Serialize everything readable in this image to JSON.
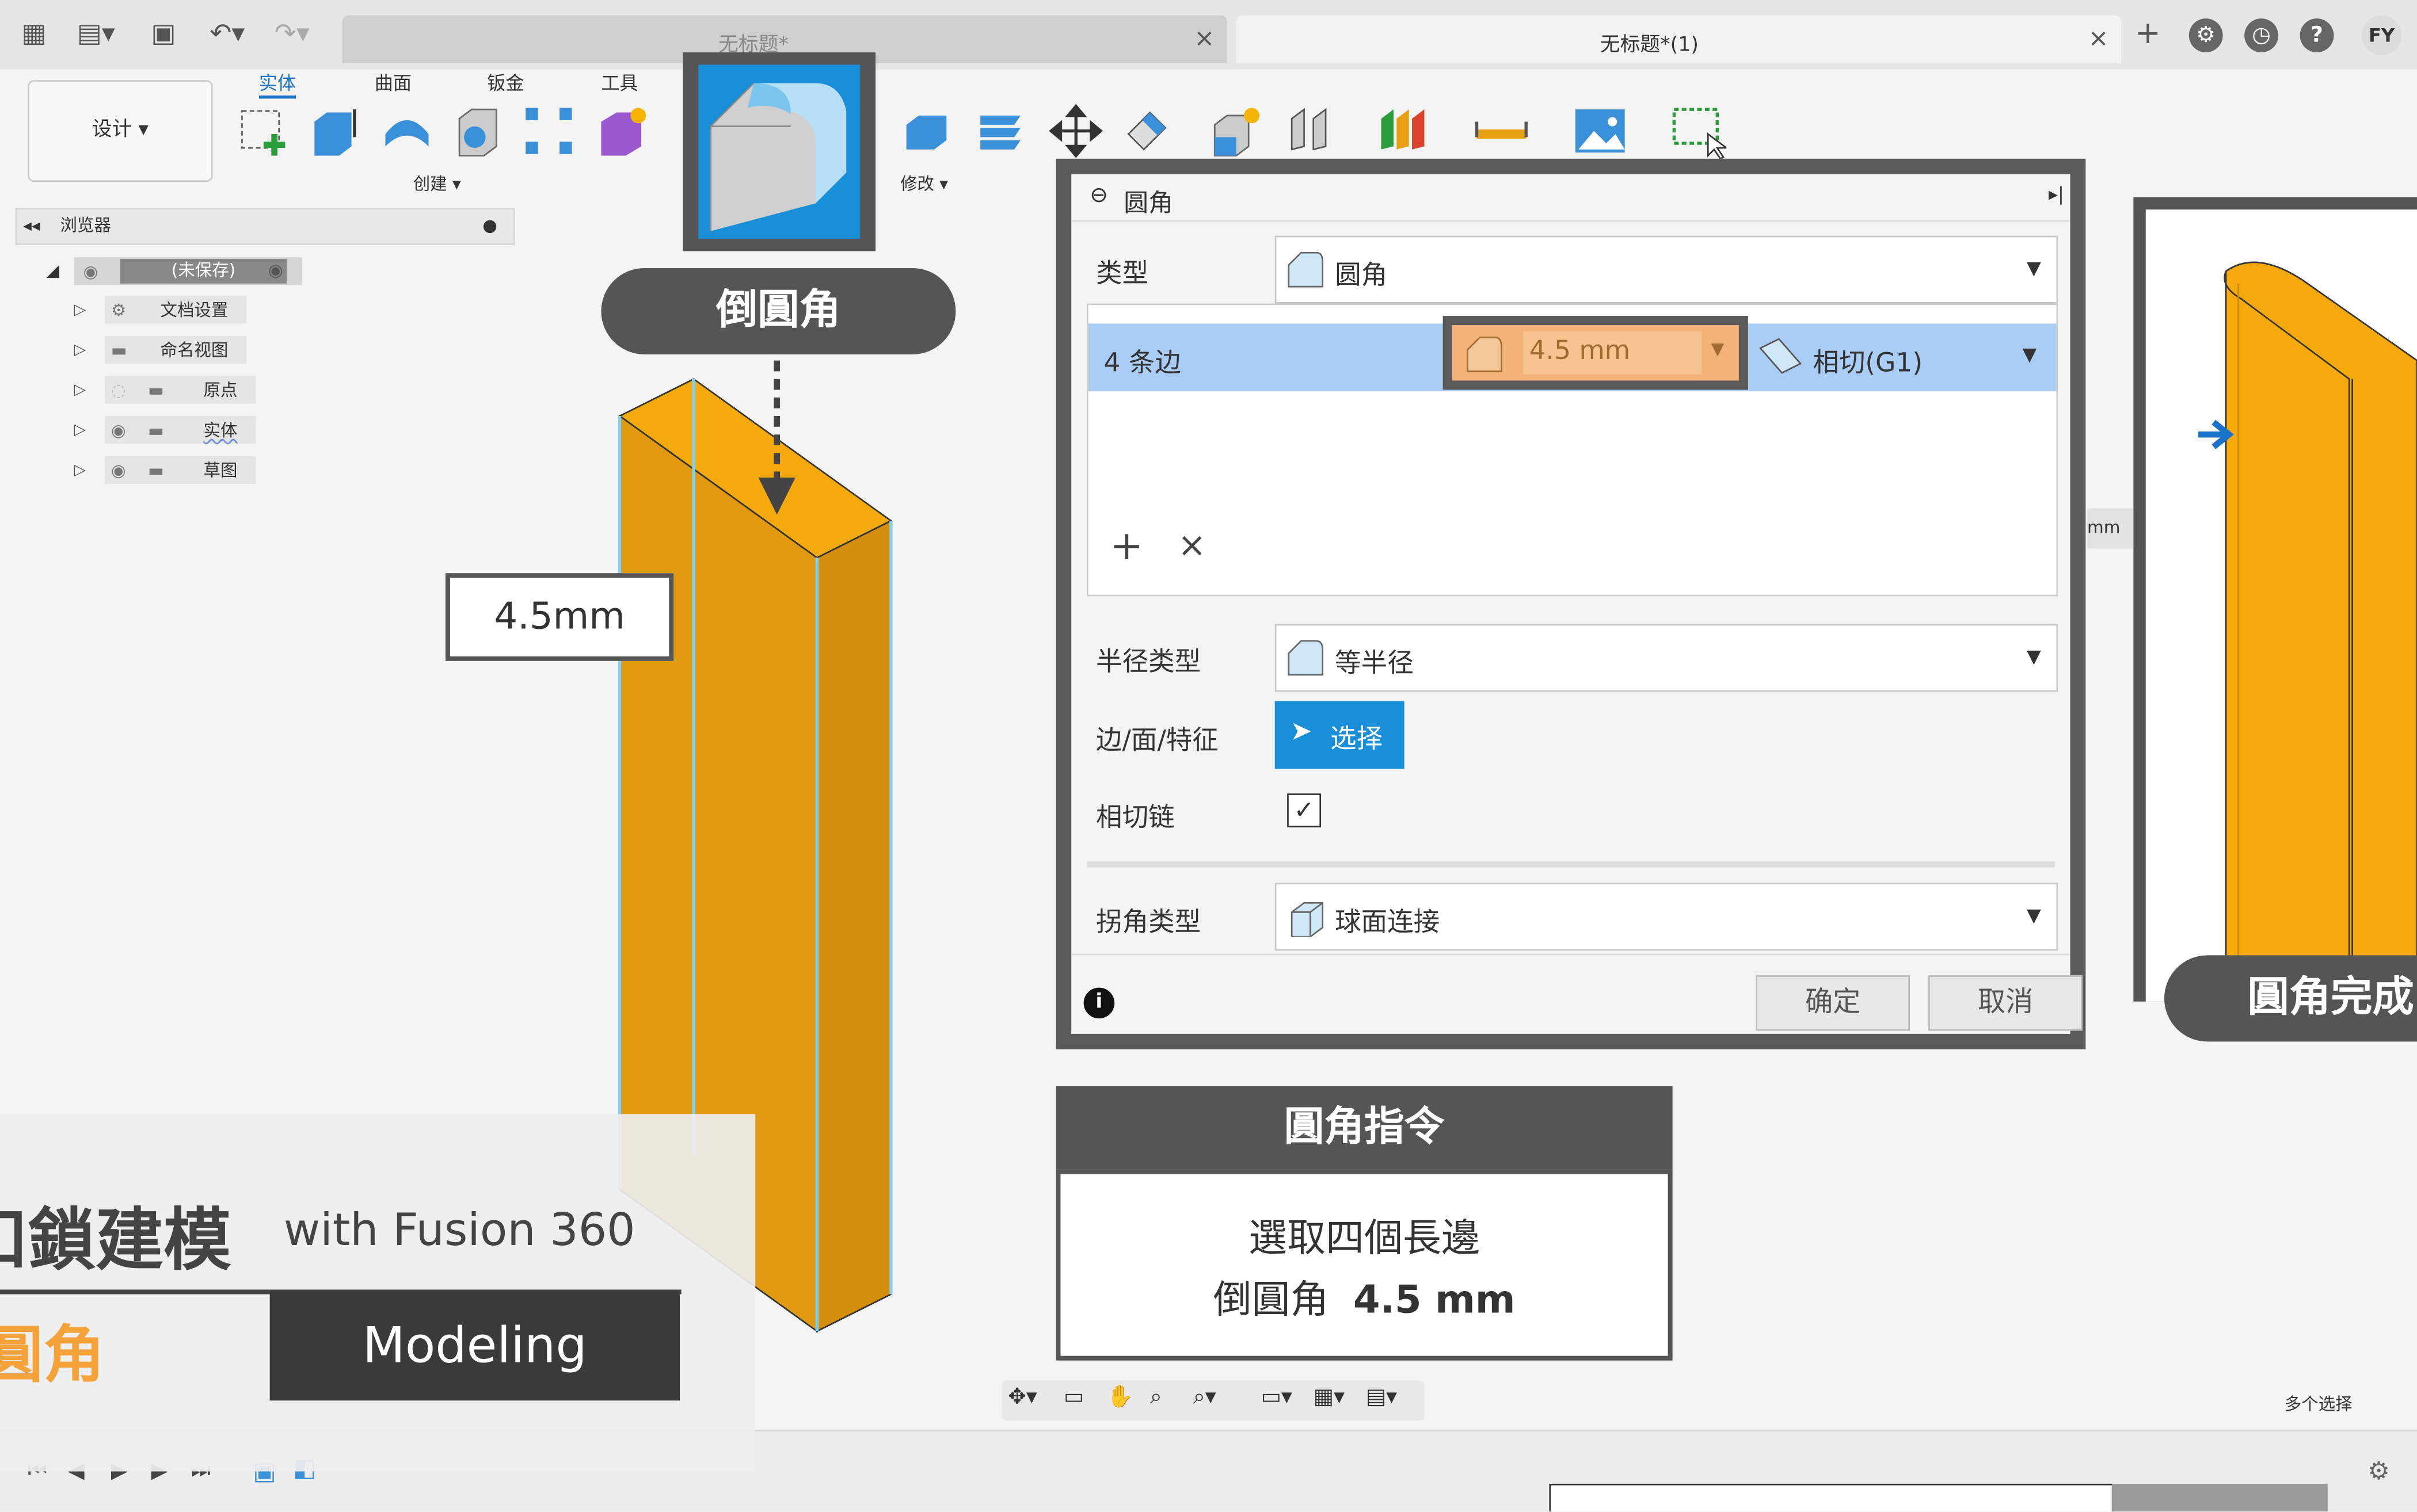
{
  "titlebar": {
    "tab_inactive": "无标题*",
    "tab_active": "无标题*(1)",
    "close_symbol": "×",
    "avatar": "FY"
  },
  "toolbar": {
    "design_label": "设计 ▾",
    "tabs": [
      "实体",
      "曲面",
      "钣金",
      "工具"
    ],
    "create_label": "创建 ▾",
    "modify_label": "修改 ▾"
  },
  "browser": {
    "title": "浏览器",
    "root": "(未保存)",
    "items": [
      "文档设置",
      "命名视图",
      "原点",
      "实体",
      "草图"
    ]
  },
  "callouts": {
    "fillet_title": "倒圓角",
    "dimension": "4.5mm",
    "fillet_done": "圓角完成"
  },
  "dialog": {
    "title": "圆角",
    "type_label": "类型",
    "type_value": "圆角",
    "edges_label": "4 条边",
    "radius_value": "4.5 mm",
    "continuity_value": "相切(G1)",
    "add_symbol": "+",
    "remove_symbol": "×",
    "radius_type_label": "半径类型",
    "radius_type_value": "等半径",
    "select_label": "边/面/特征",
    "select_button": "选择",
    "tangent_chain_label": "相切链",
    "tangent_chain_checked": true,
    "corner_type_label": "拐角类型",
    "corner_type_value": "球面连接",
    "ok": "确定",
    "cancel": "取消",
    "side_unit": "mm"
  },
  "command_box": {
    "title": "圓角指令",
    "line1": "選取四個長邊",
    "line2_prefix": "倒圓角",
    "line2_value": "4.5 mm"
  },
  "title_card": {
    "series": "扣鎖建模",
    "with": "with Fusion 360",
    "topic": "圓角",
    "modeling": "Modeling"
  },
  "status": {
    "multi_select": "多个选择"
  },
  "colors": {
    "accent_blue": "#1a73c9",
    "body_orange": "#e8a013",
    "callout_gray": "#555555",
    "highlight_orange": "#f3b277",
    "row_blue": "#a9cdf5"
  }
}
